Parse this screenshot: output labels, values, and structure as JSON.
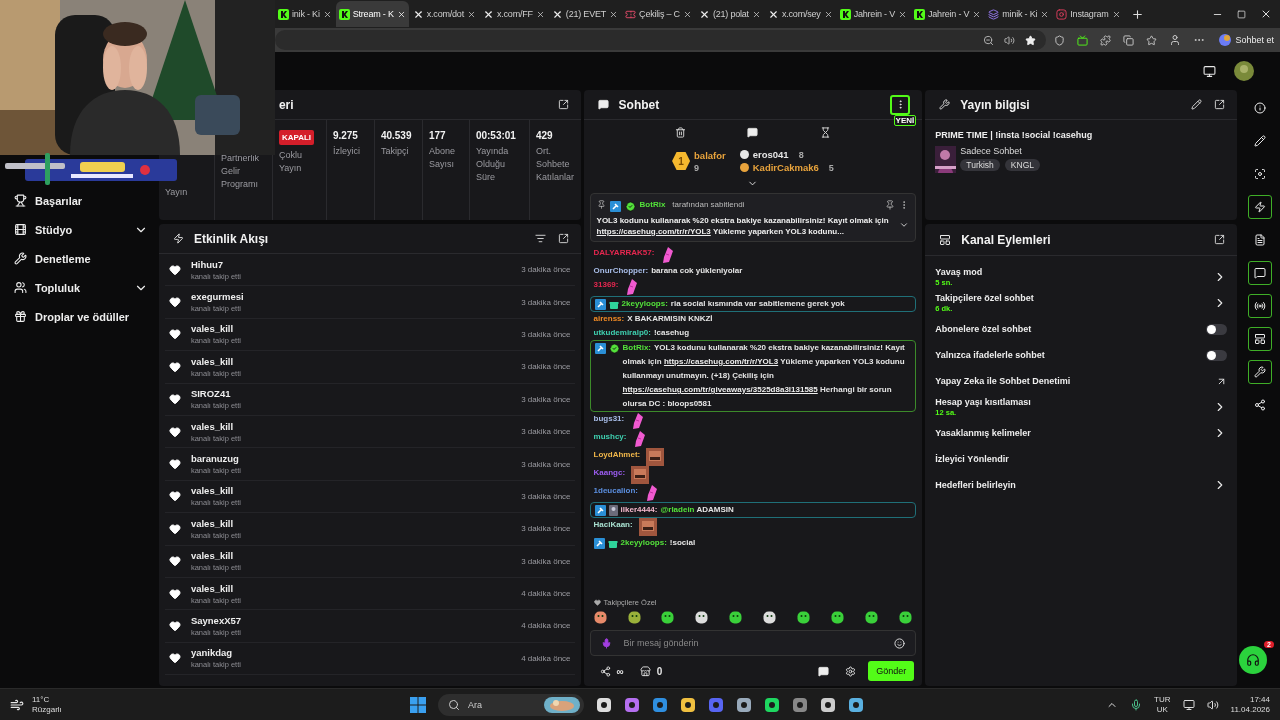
{
  "browser": {
    "tabs": [
      {
        "label": "inik - Ki",
        "selected": false
      },
      {
        "label": "Stream - K",
        "selected": true
      },
      {
        "label": "x.com/dot",
        "selected": false
      },
      {
        "label": "x.com/FF",
        "selected": false
      },
      {
        "label": "(21) EVET",
        "selected": false
      },
      {
        "label": "Çekiliş – C",
        "selected": false
      },
      {
        "label": "(21) polat",
        "selected": false
      },
      {
        "label": "x.com/sey",
        "selected": false
      },
      {
        "label": "Jahrein - V",
        "selected": false
      },
      {
        "label": "Jahrein - V",
        "selected": false
      },
      {
        "label": "minik - Ki",
        "selected": false
      },
      {
        "label": "Instagram",
        "selected": false
      }
    ],
    "copilot": "Sohbet et"
  },
  "sidebar": {
    "items": [
      {
        "label": "Başarılar",
        "expandable": false
      },
      {
        "label": "Stüdyo",
        "expandable": true
      },
      {
        "label": "Denetleme",
        "expandable": false
      },
      {
        "label": "Topluluk",
        "expandable": true
      },
      {
        "label": "Droplar ve ödüller",
        "expandable": false
      }
    ]
  },
  "stats": {
    "title": "eri",
    "items": [
      {
        "label": "Yayın"
      },
      {
        "label": "Partnerlik Gelir Programı"
      },
      {
        "badge": "KAPALI",
        "label": "Çoklu Yayın"
      },
      {
        "value": "9.275",
        "label": "İzleyici"
      },
      {
        "value": "40.539",
        "label": "Takipçi"
      },
      {
        "value": "177",
        "label": "Abone Sayısı"
      },
      {
        "value": "00:53:01",
        "label": "Yayında Olduğu Süre"
      },
      {
        "value": "429",
        "label": "Ort. Sohbete Katılanlar"
      }
    ]
  },
  "activity": {
    "title": "Etkinlik Akışı",
    "rows": [
      {
        "name": "Hihuu7",
        "event": "kanalı takip etti",
        "time": "3 dakika önce"
      },
      {
        "name": "exegurmesi",
        "event": "kanalı takip etti",
        "time": "3 dakika önce"
      },
      {
        "name": "vales_kill",
        "event": "kanalı takip etti",
        "time": "3 dakika önce"
      },
      {
        "name": "vales_kill",
        "event": "kanalı takip etti",
        "time": "3 dakika önce"
      },
      {
        "name": "SIROZ41",
        "event": "kanalı takip etti",
        "time": "3 dakika önce"
      },
      {
        "name": "vales_kill",
        "event": "kanalı takip etti",
        "time": "3 dakika önce"
      },
      {
        "name": "baranuzug",
        "event": "kanalı takip etti",
        "time": "3 dakika önce"
      },
      {
        "name": "vales_kill",
        "event": "kanalı takip etti",
        "time": "3 dakika önce"
      },
      {
        "name": "vales_kill",
        "event": "kanalı takip etti",
        "time": "3 dakika önce"
      },
      {
        "name": "vales_kill",
        "event": "kanalı takip etti",
        "time": "3 dakika önce"
      },
      {
        "name": "vales_kill",
        "event": "kanalı takip etti",
        "time": "4 dakika önce"
      },
      {
        "name": "SaynexX57",
        "event": "kanalı takip etti",
        "time": "4 dakika önce"
      },
      {
        "name": "yanikdag",
        "event": "kanalı takip etti",
        "time": "4 dakika önce"
      }
    ]
  },
  "chat": {
    "title": "Sohbet",
    "new_badge": "YENİ",
    "leaders": [
      {
        "rank": "1",
        "name": "balafor",
        "count": "9",
        "color": "#e8a33c"
      },
      {
        "name": "eros041",
        "count": "8",
        "color": "#e6e6e6"
      },
      {
        "name": "KadirCakmak6",
        "count": "5",
        "color": "#e8a33c"
      }
    ],
    "pinned": {
      "by": "BotRix",
      "note": "tarafından sabitlendi",
      "parts": [
        {
          "kind": "text",
          "text": "YOL3 kodunu kullanarak %20 ekstra bakiye kazanabilirsiniz! Kayıt olmak için "
        },
        {
          "kind": "link",
          "text": "https://casehug.com/tr/r/YOL3"
        },
        {
          "kind": "text",
          "text": " Yükleme yaparken YOL3 kodunu..."
        }
      ]
    },
    "messages": [
      {
        "kind": "emote-pink",
        "user": "DALYARRAK57:",
        "color": "#e5274f"
      },
      {
        "kind": "text",
        "user": "OnurChopper:",
        "color": "#a8bde8",
        "parts": [
          {
            "kind": "text",
            "text": "barana cok yükleniyolar"
          }
        ]
      },
      {
        "kind": "emote-pink",
        "user": "31369:",
        "color": "#e5274f"
      },
      {
        "kind": "mod-highlight",
        "gifter": true,
        "user": "2keyyloops:",
        "color": "#53e13a",
        "parts": [
          {
            "kind": "text",
            "text": "ria social kısmında var sabitlemene gerek yok"
          }
        ]
      },
      {
        "kind": "text",
        "user": "airenss:",
        "color": "#f08a24",
        "parts": [
          {
            "kind": "text",
            "text": "X BAKARMISIN KNKZİ"
          }
        ]
      },
      {
        "kind": "text",
        "user": "utkudemiralp0:",
        "color": "#3fd0b0",
        "parts": [
          {
            "kind": "text",
            "text": "!casehug"
          }
        ]
      },
      {
        "kind": "bot",
        "user": "BotRix:",
        "color": "#53e13a",
        "parts": [
          {
            "kind": "text",
            "text": "YOL3 kodunu kullanarak %20 ekstra bakiye kazanabilirsiniz! Kayıt olmak için "
          },
          {
            "kind": "link",
            "text": "https://casehug.com/tr/r/YOL3"
          },
          {
            "kind": "text",
            "text": " Yükleme yaparken YOL3 kodunu kullanmayı unutmayın. (+18) Çekiliş için "
          },
          {
            "kind": "link",
            "text": "https://casehug.com/tr/giveaways/3525d8a3l131585"
          },
          {
            "kind": "text",
            "text": " Herhangi bir sorun olursa DC : bloops0581"
          }
        ]
      },
      {
        "kind": "emote-pink",
        "user": "bugs31:",
        "color": "#a8bde8"
      },
      {
        "kind": "emote-pink",
        "user": "mushcy:",
        "color": "#3fd0b0"
      },
      {
        "kind": "emote-face",
        "user": "LoydAhmet:",
        "color": "#f0b64a"
      },
      {
        "kind": "emote-face",
        "user": "Kaangc:",
        "color": "#9b5cf0"
      },
      {
        "kind": "emote-pink",
        "user": "1deucalion:",
        "color": "#5b8fe0"
      },
      {
        "kind": "mod-highlight",
        "gifter": false,
        "user": "ilker4444:",
        "color": "#f4b8cc",
        "parts": [
          {
            "kind": "mention",
            "text": "@rladein"
          },
          {
            "kind": "text",
            "text": " ADAMSIN"
          }
        ]
      },
      {
        "kind": "emote-face",
        "user": "HaciKaan:",
        "color": "#a8e0d0"
      },
      {
        "kind": "mod",
        "gifter": true,
        "user": "2keyyloops:",
        "color": "#53e13a",
        "parts": [
          {
            "kind": "text",
            "text": "!social"
          }
        ]
      }
    ],
    "emote_label": "Takipçilere Özel",
    "placeholder": "Bir mesaj gönderin",
    "points": "∞",
    "store_count": "0",
    "send": "Gönder"
  },
  "stream_info": {
    "title": "Yayın bilgisi",
    "stream_title": "PRIME TIME | !insta !social !casehug",
    "category": "Sadece Sohbet",
    "tags": [
      "Turkish",
      "KNGL"
    ]
  },
  "actions": {
    "title": "Kanal Eylemleri",
    "rows": [
      {
        "kind": "chevron",
        "label": "Yavaş mod",
        "value": "5 sn."
      },
      {
        "kind": "chevron",
        "label": "Takipçilere özel sohbet",
        "value": "6 dk."
      },
      {
        "kind": "toggle",
        "label": "Abonelere özel sohbet",
        "on": false
      },
      {
        "kind": "toggle",
        "label": "Yalnızca ifadelerle sohbet",
        "on": false
      },
      {
        "kind": "external",
        "label": "Yapay Zeka ile Sohbet Denetimi"
      },
      {
        "kind": "chevron",
        "label": "Hesap yaşı kısıtlaması",
        "value": "12 sa."
      },
      {
        "kind": "chevron",
        "label": "Yasaklanmış kelimeler"
      },
      {
        "kind": "plain",
        "label": "İzleyici Yönlendir"
      },
      {
        "kind": "chevron",
        "label": "Hedefleri belirleyin"
      }
    ]
  },
  "rail": [
    {
      "highlighted": false
    },
    {
      "highlighted": false
    },
    {
      "highlighted": false
    },
    {
      "highlighted": true
    },
    {
      "highlighted": false
    },
    {
      "highlighted": true
    },
    {
      "highlighted": true
    },
    {
      "highlighted": true
    },
    {
      "highlighted": true
    },
    {
      "highlighted": false
    }
  ],
  "help_badge": "2",
  "taskbar": {
    "temp": "11°C",
    "weather": "Rüzgarlı",
    "search": "Ara",
    "lang": "TUR",
    "layout": "UK",
    "time": "17:44",
    "date": "11.04.2026"
  }
}
